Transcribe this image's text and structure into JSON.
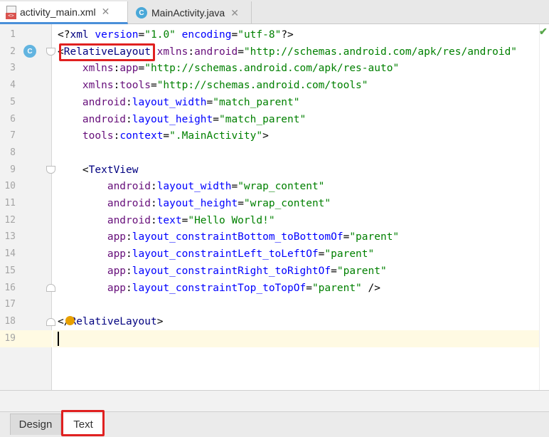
{
  "tabs": [
    {
      "label": "activity_main.xml",
      "icon": "xml-file-icon",
      "active": true
    },
    {
      "label": "MainActivity.java",
      "icon": "java-class-icon",
      "active": false
    }
  ],
  "gutter_badge": "C",
  "bottom_tabs": [
    {
      "label": "Design",
      "active": false
    },
    {
      "label": "Text",
      "active": true
    }
  ],
  "colors": {
    "tag": "#000080",
    "attribute": "#0000ff",
    "namespace": "#660e7a",
    "value": "#008000",
    "highlight": "#e02020",
    "caret_line": "#fffae3"
  },
  "lines": [
    {
      "n": "1",
      "segs": [
        [
          "p",
          "<?"
        ],
        [
          "t",
          "xml"
        ],
        [
          "a",
          " version"
        ],
        [
          "p",
          "="
        ],
        [
          "v",
          "\"1.0\""
        ],
        [
          "a",
          " encoding"
        ],
        [
          "p",
          "="
        ],
        [
          "v",
          "\"utf-8\""
        ],
        [
          "p",
          "?>"
        ]
      ]
    },
    {
      "n": "2",
      "segs": [
        [
          "p",
          "<"
        ],
        [
          "t",
          "RelativeLayout"
        ],
        [
          "ns",
          " xmlns"
        ],
        [
          "p",
          ":"
        ],
        [
          "ns",
          "android"
        ],
        [
          "p",
          "="
        ],
        [
          "v",
          "\"http://schemas.android.com/apk/res/android\""
        ]
      ]
    },
    {
      "n": "3",
      "segs": [
        [
          "ns",
          "    xmlns"
        ],
        [
          "p",
          ":"
        ],
        [
          "ns",
          "app"
        ],
        [
          "p",
          "="
        ],
        [
          "v",
          "\"http://schemas.android.com/apk/res-auto\""
        ]
      ]
    },
    {
      "n": "4",
      "segs": [
        [
          "ns",
          "    xmlns"
        ],
        [
          "p",
          ":"
        ],
        [
          "ns",
          "tools"
        ],
        [
          "p",
          "="
        ],
        [
          "v",
          "\"http://schemas.android.com/tools\""
        ]
      ]
    },
    {
      "n": "5",
      "segs": [
        [
          "ns",
          "    android"
        ],
        [
          "p",
          ":"
        ],
        [
          "a",
          "layout_width"
        ],
        [
          "p",
          "="
        ],
        [
          "v",
          "\"match_parent\""
        ]
      ]
    },
    {
      "n": "6",
      "segs": [
        [
          "ns",
          "    android"
        ],
        [
          "p",
          ":"
        ],
        [
          "a",
          "layout_height"
        ],
        [
          "p",
          "="
        ],
        [
          "v",
          "\"match_parent\""
        ]
      ]
    },
    {
      "n": "7",
      "segs": [
        [
          "ns",
          "    tools"
        ],
        [
          "p",
          ":"
        ],
        [
          "a",
          "context"
        ],
        [
          "p",
          "="
        ],
        [
          "v",
          "\".MainActivity\""
        ],
        [
          "p",
          ">"
        ]
      ]
    },
    {
      "n": "8",
      "segs": []
    },
    {
      "n": "9",
      "segs": [
        [
          "p",
          "    <"
        ],
        [
          "t",
          "TextView"
        ]
      ]
    },
    {
      "n": "10",
      "segs": [
        [
          "ns",
          "        android"
        ],
        [
          "p",
          ":"
        ],
        [
          "a",
          "layout_width"
        ],
        [
          "p",
          "="
        ],
        [
          "v",
          "\"wrap_content\""
        ]
      ]
    },
    {
      "n": "11",
      "segs": [
        [
          "ns",
          "        android"
        ],
        [
          "p",
          ":"
        ],
        [
          "a",
          "layout_height"
        ],
        [
          "p",
          "="
        ],
        [
          "v",
          "\"wrap_content\""
        ]
      ]
    },
    {
      "n": "12",
      "segs": [
        [
          "ns",
          "        android"
        ],
        [
          "p",
          ":"
        ],
        [
          "a",
          "text"
        ],
        [
          "p",
          "="
        ],
        [
          "v",
          "\"Hello World!\""
        ]
      ]
    },
    {
      "n": "13",
      "segs": [
        [
          "ns",
          "        app"
        ],
        [
          "p",
          ":"
        ],
        [
          "a",
          "layout_constraintBottom_toBottomOf"
        ],
        [
          "p",
          "="
        ],
        [
          "v",
          "\"parent\""
        ]
      ]
    },
    {
      "n": "14",
      "segs": [
        [
          "ns",
          "        app"
        ],
        [
          "p",
          ":"
        ],
        [
          "a",
          "layout_constraintLeft_toLeftOf"
        ],
        [
          "p",
          "="
        ],
        [
          "v",
          "\"parent\""
        ]
      ]
    },
    {
      "n": "15",
      "segs": [
        [
          "ns",
          "        app"
        ],
        [
          "p",
          ":"
        ],
        [
          "a",
          "layout_constraintRight_toRightOf"
        ],
        [
          "p",
          "="
        ],
        [
          "v",
          "\"parent\""
        ]
      ]
    },
    {
      "n": "16",
      "segs": [
        [
          "ns",
          "        app"
        ],
        [
          "p",
          ":"
        ],
        [
          "a",
          "layout_constraintTop_toTopOf"
        ],
        [
          "p",
          "="
        ],
        [
          "v",
          "\"parent\""
        ],
        [
          "p",
          " />"
        ]
      ]
    },
    {
      "n": "17",
      "segs": []
    },
    {
      "n": "18",
      "segs": [
        [
          "p",
          "</"
        ],
        [
          "t",
          "RelativeLayout"
        ],
        [
          "p",
          ">"
        ]
      ]
    },
    {
      "n": "19",
      "segs": []
    }
  ]
}
